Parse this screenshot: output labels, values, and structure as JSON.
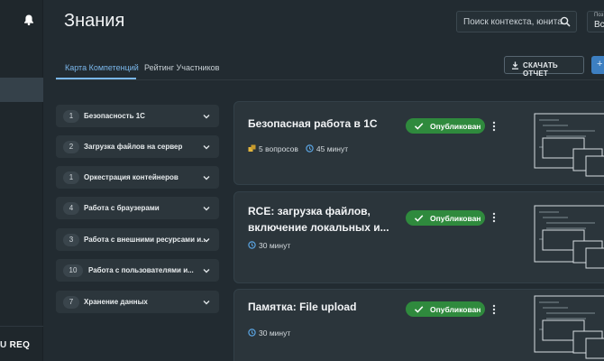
{
  "page": {
    "title": "Знания"
  },
  "search": {
    "placeholder": "Поиск контекста, юнита"
  },
  "filter": {
    "label": "Поз",
    "value": "Вс"
  },
  "rail": {
    "brand_left": "U",
    "brand_right": "REQ"
  },
  "tabs": [
    {
      "label": "Карта Компетенций",
      "active": true
    },
    {
      "label": "Рейтинг Участников",
      "active": false
    }
  ],
  "toolbar": {
    "report_label": "СКАЧАТЬ ОТЧЕТ",
    "add_label": "+"
  },
  "competencies": [
    {
      "count": "1",
      "label": "Безопасность 1С"
    },
    {
      "count": "2",
      "label": "Загрузка файлов на сервер"
    },
    {
      "count": "1",
      "label": "Оркестрация контейнеров"
    },
    {
      "count": "4",
      "label": "Работа с браузерами"
    },
    {
      "count": "3",
      "label": "Работа с внешними ресурсами и..."
    },
    {
      "count": "10",
      "label": "Работа с пользователями и..."
    },
    {
      "count": "7",
      "label": "Хранение данных"
    }
  ],
  "cards": [
    {
      "title": "Безопасная работа в 1С",
      "questions": "5 вопросов",
      "duration": "45 минут",
      "status": "Опубликован"
    },
    {
      "title": "RCE: загрузка файлов, включение локальных и...",
      "questions": "",
      "duration": "30 минут",
      "status": "Опубликован"
    },
    {
      "title": "Памятка: File upload",
      "questions": "",
      "duration": "30 минут",
      "status": "Опубликован"
    }
  ],
  "colors": {
    "accent": "#7ab6ea",
    "published": "#2f8a3d",
    "background": "#222b31",
    "card": "#2b353b"
  }
}
